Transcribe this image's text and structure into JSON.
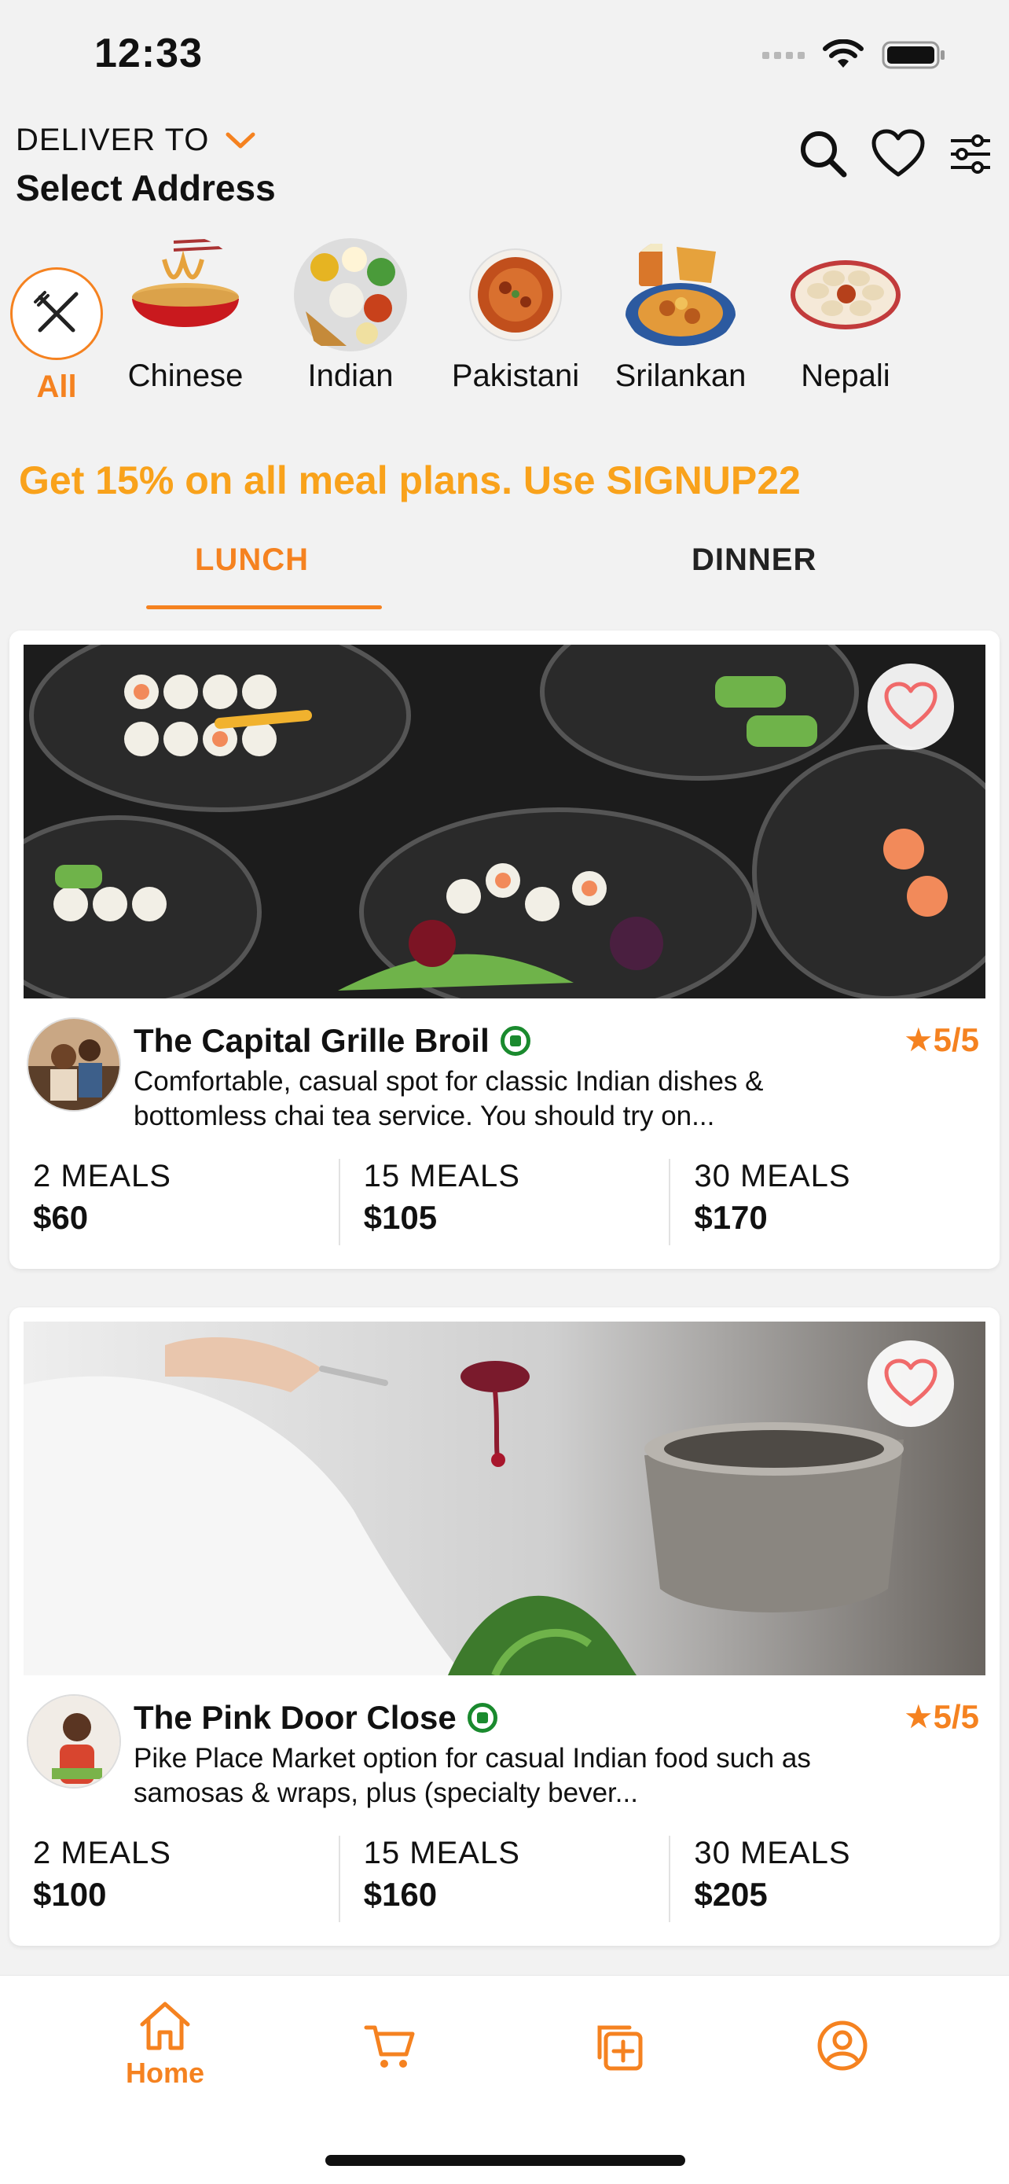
{
  "status_bar": {
    "time": "12:33"
  },
  "header": {
    "deliver_label": "DELIVER TO",
    "address": "Select Address"
  },
  "categories": [
    {
      "label": "All",
      "icon": "fork-knife-icon",
      "selected": true
    },
    {
      "label": "Chinese",
      "icon": "noodle-bowl"
    },
    {
      "label": "Indian",
      "icon": "thali-plate"
    },
    {
      "label": "Pakistani",
      "icon": "curry-bowl"
    },
    {
      "label": "Srilankan",
      "icon": "platter"
    },
    {
      "label": "Nepali",
      "icon": "momo-plate"
    }
  ],
  "promo": "Get 15% on all meal plans. Use SIGNUP22",
  "tabs": [
    {
      "label": "LUNCH",
      "active": true
    },
    {
      "label": "DINNER",
      "active": false
    }
  ],
  "restaurants": [
    {
      "name": "The Capital Grille Broil",
      "rating": "★5/5",
      "description": "Comfortable, casual spot for classic Indian dishes & bottomless chai tea service. You should try on...",
      "plans": [
        {
          "label": "2 MEALS",
          "price": "$60"
        },
        {
          "label": "15 MEALS",
          "price": "$105"
        },
        {
          "label": "30 MEALS",
          "price": "$170"
        }
      ]
    },
    {
      "name": "The Pink Door Close",
      "rating": "★5/5",
      "description": "Pike Place Market option for casual Indian food such as samosas & wraps, plus (specialty bever...",
      "plans": [
        {
          "label": "2 MEALS",
          "price": "$100"
        },
        {
          "label": "15 MEALS",
          "price": "$160"
        },
        {
          "label": "30 MEALS",
          "price": "$205"
        }
      ]
    }
  ],
  "bottom_nav": {
    "home_label": "Home",
    "items": [
      "home-icon",
      "cart-icon",
      "add-plan-icon",
      "profile-icon"
    ]
  },
  "colors": {
    "accent": "#f58220",
    "promo": "#f9a21b",
    "veg": "#1a8a2e",
    "background": "#f2f2f2"
  }
}
